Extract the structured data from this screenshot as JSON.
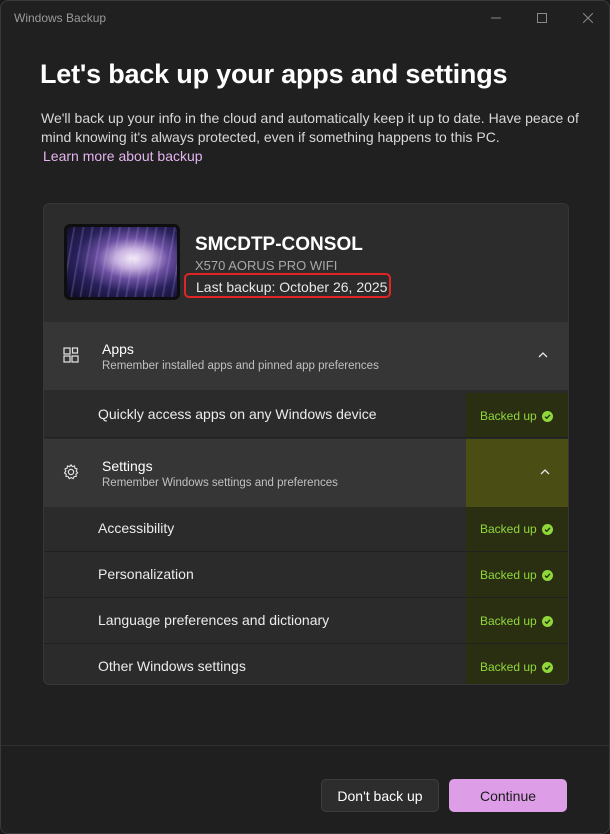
{
  "window": {
    "title": "Windows Backup"
  },
  "page": {
    "heading": "Let's back up your apps and settings",
    "description": "We'll back up your info in the cloud and automatically keep it up to date. Have peace of mind knowing it's always protected, even if something happens to this PC.",
    "learn_more": "Learn more about backup"
  },
  "device": {
    "name": "SMCDTP-CONSOL",
    "model": "X570 AORUS PRO WIFI",
    "last_backup": "Last backup: October 26, 2025"
  },
  "apps": {
    "title": "Apps",
    "subtitle": "Remember installed apps and pinned app preferences",
    "items": [
      {
        "label": "Quickly access apps on any Windows device",
        "status": "Backed up"
      }
    ]
  },
  "settings": {
    "title": "Settings",
    "subtitle": "Remember Windows settings and preferences",
    "items": [
      {
        "label": "Accessibility",
        "status": "Backed up"
      },
      {
        "label": "Personalization",
        "status": "Backed up"
      },
      {
        "label": "Language preferences and dictionary",
        "status": "Backed up"
      },
      {
        "label": "Other Windows settings",
        "status": "Backed up"
      }
    ]
  },
  "buttons": {
    "secondary": "Don't back up",
    "primary": "Continue"
  },
  "colors": {
    "accent": "#dd9de7",
    "link": "#e3b4ef",
    "success": "#8fd83a",
    "highlight_box": "#e02424"
  }
}
